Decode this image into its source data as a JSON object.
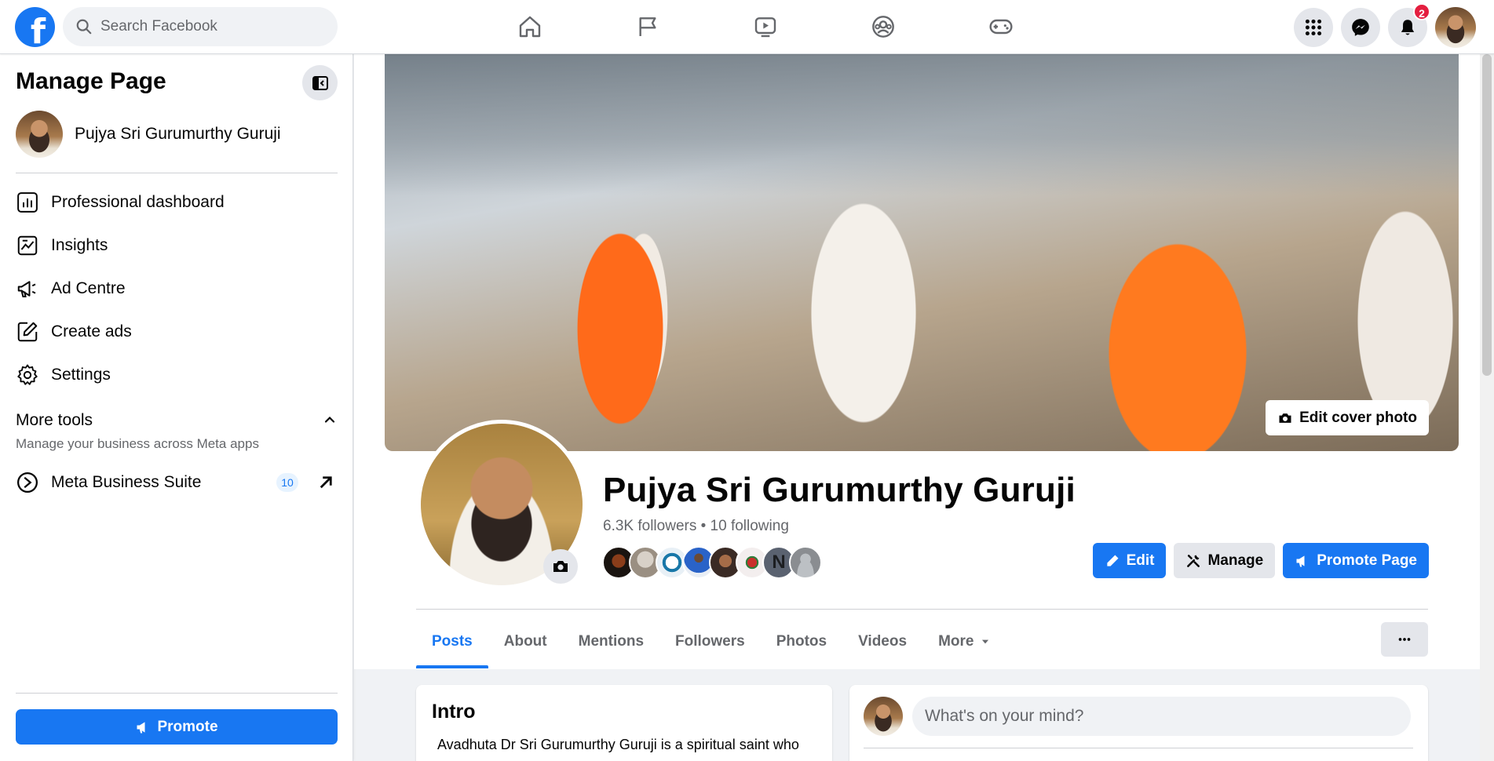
{
  "topbar": {
    "logo_letter": "f",
    "search_placeholder": "Search Facebook",
    "nav": [
      {
        "name": "home-icon"
      },
      {
        "name": "flag-icon"
      },
      {
        "name": "video-icon"
      },
      {
        "name": "groups-icon"
      },
      {
        "name": "gaming-icon"
      }
    ],
    "notifications_count": "2"
  },
  "sidebar": {
    "title": "Manage Page",
    "page_name": "Pujya Sri Gurumurthy Guruji",
    "items": [
      {
        "label": "Professional dashboard",
        "icon": "dashboard-icon"
      },
      {
        "label": "Insights",
        "icon": "insights-icon"
      },
      {
        "label": "Ad Centre",
        "icon": "megaphone-icon"
      },
      {
        "label": "Create ads",
        "icon": "pencil-square-icon"
      },
      {
        "label": "Settings",
        "icon": "gear-icon"
      }
    ],
    "more_tools": {
      "heading": "More tools",
      "subtext": "Manage your business across Meta apps",
      "item": {
        "label": "Meta Business Suite",
        "count": "10"
      }
    },
    "promote_label": "Promote"
  },
  "profile": {
    "edit_cover_label": "Edit cover photo",
    "name": "Pujya Sri Gurumurthy Guruji",
    "followers_line": "6.3K followers • 10 following",
    "follower_avatar_initial": "N",
    "actions": {
      "edit": "Edit",
      "manage": "Manage",
      "promote_page": "Promote Page"
    },
    "tabs": [
      "Posts",
      "About",
      "Mentions",
      "Followers",
      "Photos",
      "Videos",
      "More"
    ],
    "active_tab": "Posts"
  },
  "intro": {
    "heading": "Intro",
    "text": "Avadhuta Dr Sri Gurumurthy Guruji is a spiritual saint who"
  },
  "composer": {
    "placeholder": "What's on your mind?"
  },
  "colors": {
    "brand_blue": "#1877f2",
    "badge_red": "#e41e3f",
    "bg_grey": "#f0f2f5"
  }
}
